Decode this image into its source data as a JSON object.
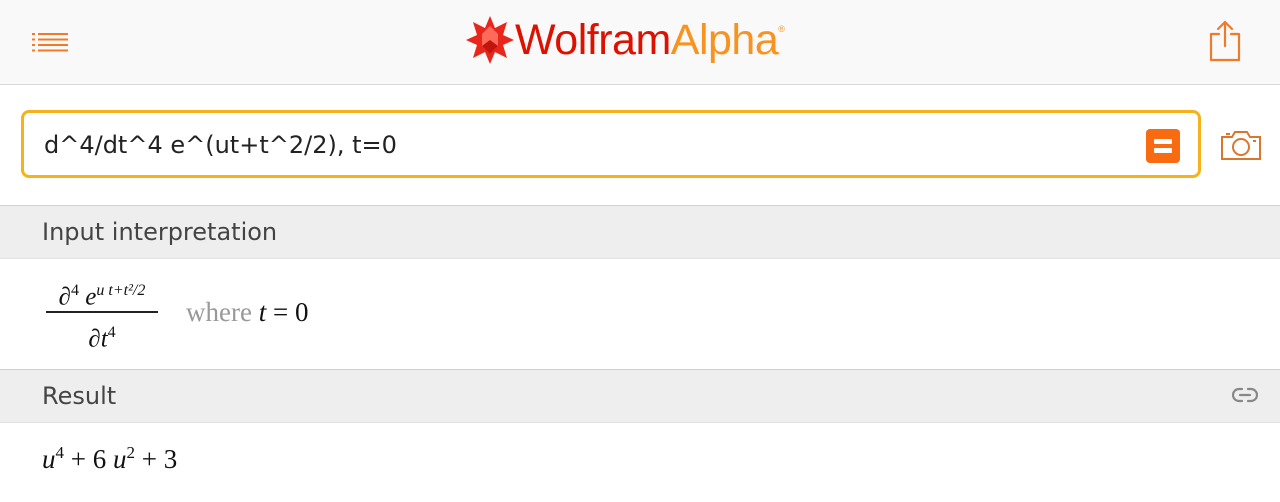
{
  "header": {
    "logo_part1": "Wolfram",
    "logo_part2": "Alpha",
    "logo_reg": "®",
    "icons": {
      "menu": "list-icon",
      "share": "share-icon"
    }
  },
  "search": {
    "value": "d^4/dt^4 e^(ut+t^2/2), t=0",
    "submit_icon": "equals-icon",
    "camera_icon": "camera-icon",
    "accent_color": "#f96b10",
    "border_color": "#f6b21b"
  },
  "pods": [
    {
      "title": "Input interpretation",
      "math": {
        "num_d": "∂",
        "num_d_exp": "4",
        "num_e": "e",
        "num_exp": "u t+t²/2",
        "den_d": "∂",
        "den_t": "t",
        "den_exp": "4",
        "where": "where",
        "var": "t",
        "eq": " = 0"
      }
    },
    {
      "title": "Result",
      "link_icon": "link-icon",
      "math": {
        "u1": "u",
        "e1": "4",
        "mid": " + 6 ",
        "u2": "u",
        "e2": "2",
        "end": " + 3"
      }
    }
  ]
}
